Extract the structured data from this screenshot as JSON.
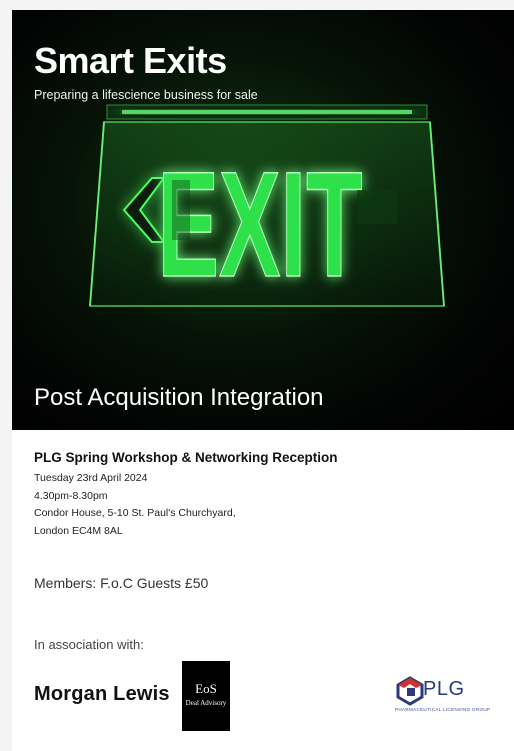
{
  "hero": {
    "title": "Smart Exits",
    "subtitle": "Preparing a lifescience business for sale",
    "sign_text": "EXIT",
    "caption": "Post Acquisition Integration"
  },
  "event": {
    "title": "PLG Spring Workshop & Networking Reception",
    "date": "Tuesday 23rd April 2024",
    "time": "4.30pm-8.30pm",
    "address_line1": "Condor House, 5-10 St. Paul's Churchyard,",
    "address_line2": "London EC4M 8AL"
  },
  "pricing": "Members: F.o.C  Guests £50",
  "association_label": "In association with:",
  "sponsors": {
    "morgan_lewis": "Morgan Lewis",
    "eos_mark": "EoS",
    "eos_sub": "Deal Advisory",
    "plg_name": "PLG",
    "plg_full": "PHARMACEUTICAL LICENSING GROUP"
  },
  "colors": {
    "exit_green": "#3dff5a",
    "plg_blue": "#2a3a7a",
    "plg_red": "#d62f2f"
  }
}
